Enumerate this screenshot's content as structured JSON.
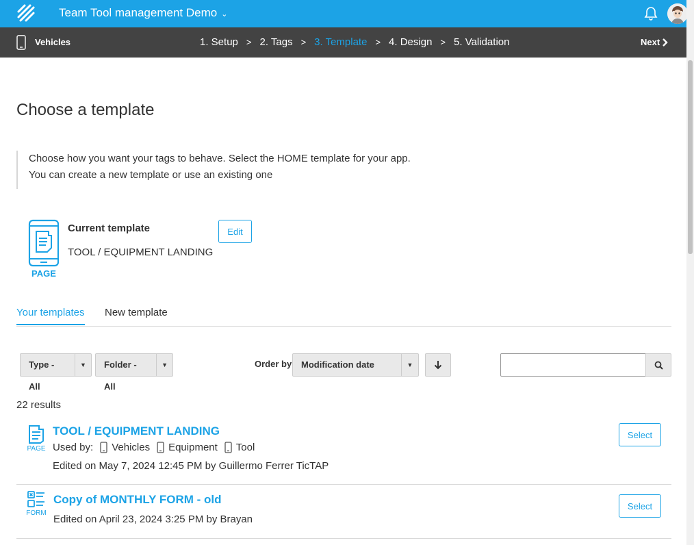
{
  "topbar": {
    "app_title": "Team Tool management Demo",
    "icons": {
      "logo": "tictap-logo",
      "chevron": "chevron-down-icon",
      "bell": "bell-icon",
      "avatar": "user-avatar"
    }
  },
  "stepbar": {
    "context_label": "Vehicles",
    "steps": [
      {
        "label": "1. Setup",
        "active": false
      },
      {
        "label": "2. Tags",
        "active": false
      },
      {
        "label": "3. Template",
        "active": true
      },
      {
        "label": "4. Design",
        "active": false
      },
      {
        "label": "5. Validation",
        "active": false
      }
    ],
    "separator": ">",
    "next_label": "Next"
  },
  "page": {
    "title": "Choose a template",
    "intro_line1": "Choose how you want your tags to behave. Select the HOME template for your app.",
    "intro_line2": "You can create a new template or use an existing one"
  },
  "current_template": {
    "icon_label": "PAGE",
    "heading": "Current template",
    "name": "TOOL / EQUIPMENT LANDING",
    "edit_label": "Edit"
  },
  "tabs": [
    {
      "label": "Your templates",
      "active": true
    },
    {
      "label": "New template",
      "active": false
    }
  ],
  "filters": {
    "type": "Type - All",
    "folder": "Folder - All",
    "order_label": "Order by",
    "order_value": "Modification date",
    "search_value": ""
  },
  "results": {
    "count_text": "22 results",
    "items": [
      {
        "icon_label": "PAGE",
        "title": "TOOL / EQUIPMENT LANDING",
        "used_by_label": "Used by:",
        "used_by": [
          "Vehicles",
          "Equipment",
          "Tool"
        ],
        "edited": "Edited on May 7, 2024 12:45 PM by Guillermo Ferrer TicTAP",
        "select_label": "Select"
      },
      {
        "icon_label": "FORM",
        "title": "Copy of MONTHLY FORM - old",
        "edited": "Edited on April 23, 2024 3:25 PM by Brayan",
        "select_label": "Select"
      }
    ]
  },
  "colors": {
    "accent": "#1ca3e6",
    "stepbar": "#434343",
    "text": "#333333"
  }
}
